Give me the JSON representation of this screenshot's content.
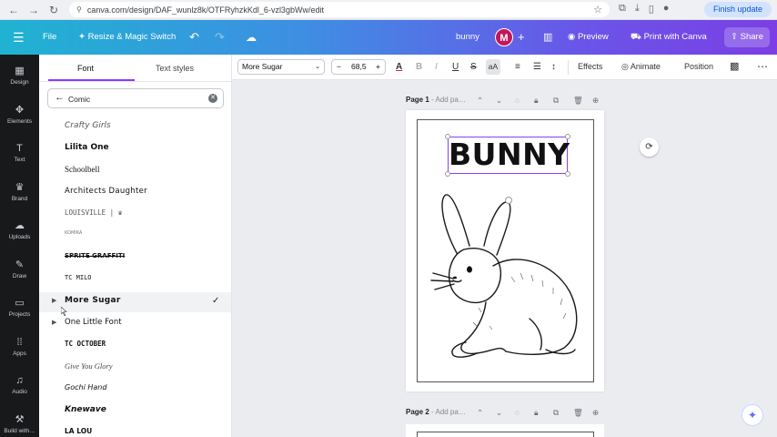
{
  "browser": {
    "url": "canva.com/design/DAF_wunlz8k/OTFRyhzkKdl_6-vzl3gbWw/edit",
    "finish_update": "Finish update"
  },
  "header": {
    "file": "File",
    "resize": "Resize & Magic Switch",
    "doc_title": "bunny",
    "avatar_letter": "M",
    "preview": "Preview",
    "print": "Print with Canva",
    "share": "Share"
  },
  "rail": [
    {
      "label": "Design",
      "icon": "▦"
    },
    {
      "label": "Elements",
      "icon": "✥"
    },
    {
      "label": "Text",
      "icon": "T"
    },
    {
      "label": "Brand",
      "icon": "♛"
    },
    {
      "label": "Uploads",
      "icon": "☁"
    },
    {
      "label": "Draw",
      "icon": "✎"
    },
    {
      "label": "Projects",
      "icon": "▭"
    },
    {
      "label": "Apps",
      "icon": "⁞⁞"
    },
    {
      "label": "Audio",
      "icon": "♫"
    },
    {
      "label": "Build with…",
      "icon": "⚒"
    }
  ],
  "panel": {
    "tab_font": "Font",
    "tab_styles": "Text styles",
    "search_value": "Comic",
    "fonts": [
      {
        "name": "Crafty Girls",
        "selected": false,
        "expandable": false
      },
      {
        "name": "Lilita One",
        "selected": false,
        "expandable": false
      },
      {
        "name": "Schoolbell",
        "selected": false,
        "expandable": false
      },
      {
        "name": "Architects Daughter",
        "selected": false,
        "expandable": false
      },
      {
        "name": "LOUISVILLE | ♛",
        "selected": false,
        "expandable": false
      },
      {
        "name": "KOMIKA",
        "selected": false,
        "expandable": false
      },
      {
        "name": "SPRITE GRAFFITI",
        "selected": false,
        "expandable": false
      },
      {
        "name": "TC MILO",
        "selected": false,
        "expandable": false
      },
      {
        "name": "More Sugar",
        "selected": true,
        "expandable": true
      },
      {
        "name": "One Little Font",
        "selected": false,
        "expandable": true
      },
      {
        "name": "TC OCTOBER",
        "selected": false,
        "expandable": false
      },
      {
        "name": "Give You Glory",
        "selected": false,
        "expandable": false
      },
      {
        "name": "Gochi Hand",
        "selected": false,
        "expandable": false
      },
      {
        "name": "Knewave",
        "selected": false,
        "expandable": false
      },
      {
        "name": "LA LOU",
        "selected": false,
        "expandable": false
      }
    ]
  },
  "toolbar": {
    "font_name": "More Sugar",
    "font_size": "68,5",
    "color_glyph": "A",
    "bold": "B",
    "italic": "I",
    "underline": "U",
    "strike": "S",
    "case": "aA",
    "effects": "Effects",
    "animate": "Animate",
    "position": "Position"
  },
  "canvas": {
    "page1_title": "Page 1",
    "page1_add": "- Add pa…",
    "page2_title": "Page 2",
    "page2_add": "- Add pa…",
    "heading_text": "BUNNY"
  },
  "colors": {
    "accent": "#8b3dff",
    "rail_bg": "#18191b",
    "canvas_bg": "#ebecf0"
  }
}
